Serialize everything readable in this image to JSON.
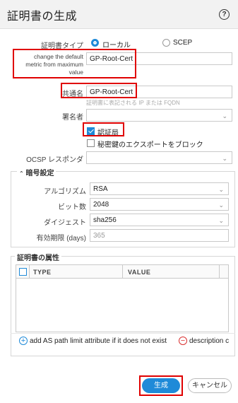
{
  "header": {
    "title": "証明書の生成",
    "help_icon": "?"
  },
  "cert_type": {
    "label": "証明書タイプ",
    "local": "ローカル",
    "scep": "SCEP"
  },
  "cert_name": {
    "label": "change the default metric from maximum value",
    "value": "GP-Root-Cert"
  },
  "common_name": {
    "label": "共通名",
    "value": "GP-Root-Cert",
    "hint": "証明書に表記される IP または FQDN"
  },
  "signed_by": {
    "label": "署名者",
    "value": ""
  },
  "ca": {
    "label": "認証局",
    "checked": true
  },
  "block_export": {
    "label": "秘密鍵のエクスポートをブロック",
    "checked": false
  },
  "ocsp": {
    "label": "OCSP レスポンダ",
    "value": ""
  },
  "crypto": {
    "legend": "暗号設定",
    "algorithm": {
      "label": "アルゴリズム",
      "value": "RSA"
    },
    "bits": {
      "label": "ビット数",
      "value": "2048"
    },
    "digest": {
      "label": "ダイジェスト",
      "value": "sha256"
    },
    "expiry": {
      "label": "有効期限 (days)",
      "value": "365"
    }
  },
  "attributes": {
    "legend": "証明書の属性",
    "columns": [
      "TYPE",
      "VALUE"
    ],
    "add_label": "add AS path limit attribute if it does not exist",
    "delete_label": "description c"
  },
  "footer": {
    "generate": "生成",
    "cancel": "キャンセル"
  },
  "colors": {
    "accent": "#1f8ad8",
    "highlight": "#e00000"
  }
}
